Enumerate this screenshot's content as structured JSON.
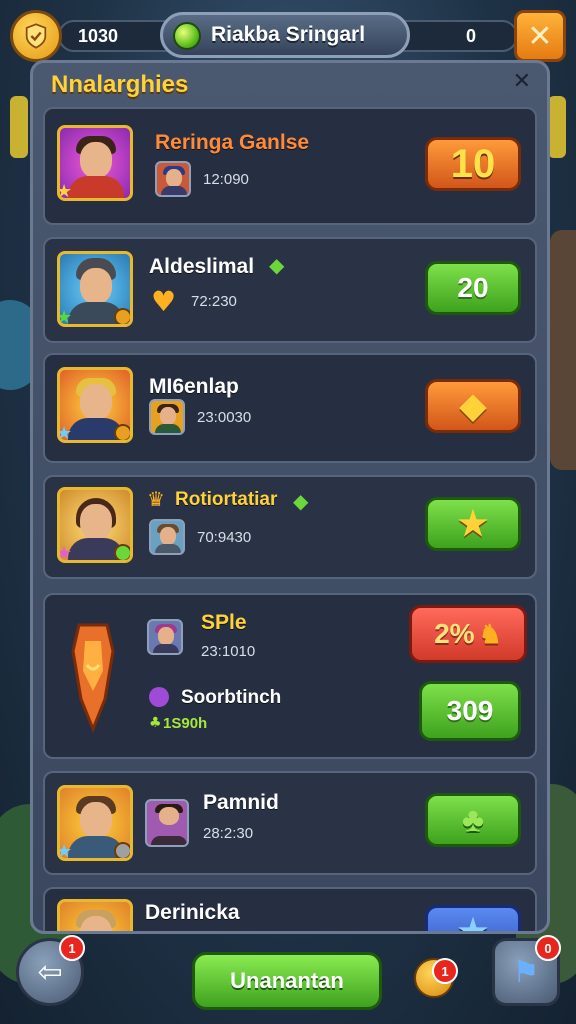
{
  "topbar": {
    "left_value": "1030",
    "title": "Riakba Sringarl",
    "right_value": "0",
    "close_label": "✕"
  },
  "panel": {
    "title": "Nnalarghies",
    "close_label": "✕"
  },
  "rows": [
    {
      "name": "Reringa Ganlse",
      "time": "12:090",
      "action": "10",
      "action_type": "orange-number"
    },
    {
      "name": "Aldeslimal",
      "time": "72:230",
      "action": "20",
      "action_type": "green-number"
    },
    {
      "name": "MI6enlap",
      "time": "23:0030",
      "action": "",
      "action_type": "orange-icon",
      "icon": "gem-icon"
    },
    {
      "name": "Rotiortatiar",
      "time": "70:9430",
      "action": "",
      "action_type": "green-icon",
      "icon": "star-icon"
    },
    {
      "name": "SPle",
      "time": "23:1010",
      "action": "2%",
      "action_type": "red-number",
      "sub_name": "Soorbtinch",
      "sub_time": "1S90h",
      "sub_action": "309"
    },
    {
      "name": "Pamnid",
      "time": "28:2:30",
      "action": "",
      "action_type": "green-icon",
      "icon": "leaf-icon"
    },
    {
      "name": "Derinicka",
      "time": "",
      "action": "",
      "action_type": "blue-icon",
      "icon": "star-icon"
    }
  ],
  "bottom": {
    "back_badge": "1",
    "main_button": "Unanantan",
    "coin_badge": "1",
    "map_badge": "0"
  },
  "colors": {
    "accent_gold": "#ffd23a",
    "green_button": "#3ea21e",
    "orange_button": "#d2561a",
    "panel_bg": "#3a475e"
  }
}
